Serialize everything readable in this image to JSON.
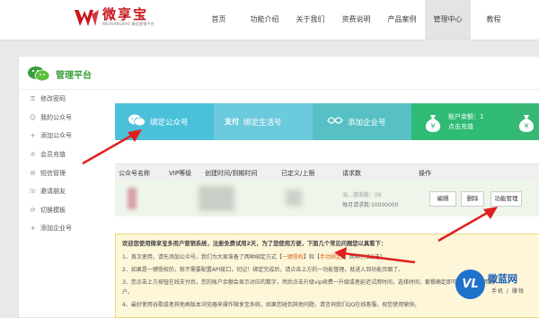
{
  "brand": {
    "name": "微享宝",
    "subtitle": "WEIXIANGBAO 微信营销平台",
    "color": "#c8161d"
  },
  "nav": {
    "items": [
      "首页",
      "功能介绍",
      "关于我们",
      "资费说明",
      "产品案例",
      "管理中心",
      "教程"
    ],
    "active_index": 5
  },
  "panel": {
    "title": "管理平台",
    "title_color": "#3a9d3d"
  },
  "sidebar": {
    "items": [
      {
        "label": "修改密码",
        "icon": "lock-icon"
      },
      {
        "label": "我的公众号",
        "icon": "user-icon"
      },
      {
        "label": "添加公众号",
        "icon": "plus-icon"
      },
      {
        "label": "会员充值",
        "icon": "member-icon"
      },
      {
        "label": "短信管理",
        "icon": "sms-icon"
      },
      {
        "label": "邀请朋友",
        "icon": "invite-icon"
      },
      {
        "label": "切换模板",
        "icon": "switch-icon"
      },
      {
        "label": "添加企业号",
        "icon": "plus-icon"
      }
    ]
  },
  "cards": [
    {
      "label": "绑定公众号",
      "icon": "wechat-icon",
      "color": "#4bc0db"
    },
    {
      "label": "绑定生活号",
      "icon": "alipay-icon",
      "color": "#6ccadd"
    },
    {
      "label": "添加企业号",
      "icon": "enterprise-icon",
      "color": "#57c0c4"
    },
    {
      "label_line1": "账户余额：1",
      "label_line2": "点击充值",
      "icon": "money-bag-icon",
      "color": "#2fbb74"
    }
  ],
  "table": {
    "headers": [
      "公众号名称",
      "VIP等级",
      "创建时间/到期时间",
      "已定义/上限",
      "请求数",
      "操作"
    ],
    "row": {
      "request_line1": "当...请求数：28",
      "request_line2": "每月请求数:10000000",
      "actions": [
        "编辑",
        "删除",
        "功能管理"
      ]
    }
  },
  "notice": {
    "title": "欢迎您使用微享宝多用户营销系统，注册免费试用2天，为了您使用方便，下面几个常见问题您以真看下：",
    "lines": [
      {
        "prefix": "1、首次使用，请先添加公众号，我们为大家准备了两种绑定方式【",
        "link1": "一键授权",
        "mid": "】和【",
        "link2": "手动绑定",
        "suffix": "】，两种方法2选1"
      },
      {
        "text": "2、如果是一键授权的，就不需要配置API接口，切记！绑定完成后，请点击上方的一功能管理，就进入到功能页面了。"
      },
      {
        "text": "3、您点击上方按钮在线支付后，您的账户余额会显示对应的数字，然后点击升级vip续费一升级或者延迟试用时间，选择时间，套餐确定即可，如果是试用账"
      },
      {
        "text": "户。"
      },
      {
        "text": "4、最好使用谷歌或者其他高版本浏览器来操作微享宝系统，如果您碰到其他问题，请咨询我们QQ在线客服，祝您使用愉快。"
      }
    ]
  },
  "watermark": {
    "badge": "VL",
    "name": "微蓝网",
    "sub": "手机 / 赚钱"
  }
}
